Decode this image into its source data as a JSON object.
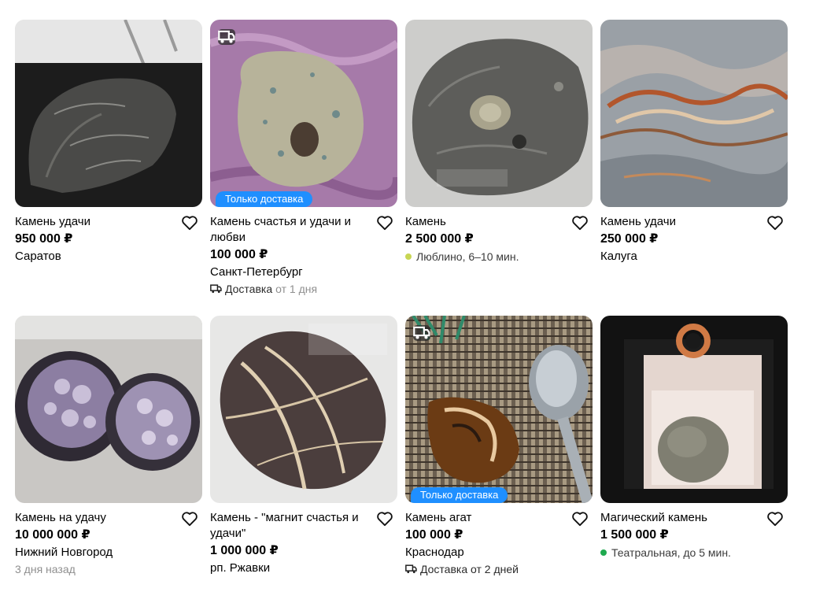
{
  "listings": [
    {
      "title": "Камень удачи",
      "price": "950 000 ₽",
      "location": "Саратов",
      "heart_icon": "heart-outline-icon"
    },
    {
      "title": "Камень счастья и удачи и любви",
      "price": "100 000 ₽",
      "location": "Санкт-Петербург",
      "badge": "Только доставка",
      "delivery_prefix": "Доставка",
      "delivery_suffix": "от 1 дня",
      "heart_icon": "heart-outline-icon"
    },
    {
      "title": "Камень",
      "price": "2 500 000 ₽",
      "metro": "Люблино, 6–10 мин.",
      "metro_color": "#c8d654",
      "heart_icon": "heart-outline-icon"
    },
    {
      "title": "Камень удачи",
      "price": "250 000 ₽",
      "location": "Калуга",
      "heart_icon": "heart-outline-icon"
    },
    {
      "title": "Камень на удачу",
      "price": "10 000 000 ₽",
      "location": "Нижний Новгород",
      "date": "3 дня назад",
      "heart_icon": "heart-outline-icon"
    },
    {
      "title": "Камень - \"магнит счастья и удачи\"",
      "price": "1 000 000 ₽",
      "location": "рп. Ржавки",
      "heart_icon": "heart-outline-icon"
    },
    {
      "title": "Камень агат",
      "price": "100 000 ₽",
      "location": "Краснодар",
      "badge": "Только доставка",
      "delivery_full": "Доставка от 2 дней",
      "heart_icon": "heart-outline-icon"
    },
    {
      "title": "Магический камень",
      "price": "1 500 000 ₽",
      "metro": "Театральная, до 5 мин.",
      "metro_color": "#1faa4f",
      "heart_icon": "heart-outline-icon"
    }
  ],
  "colors": {
    "badge_blue": "#1f8fff",
    "muted_text": "#8f8f8f"
  }
}
